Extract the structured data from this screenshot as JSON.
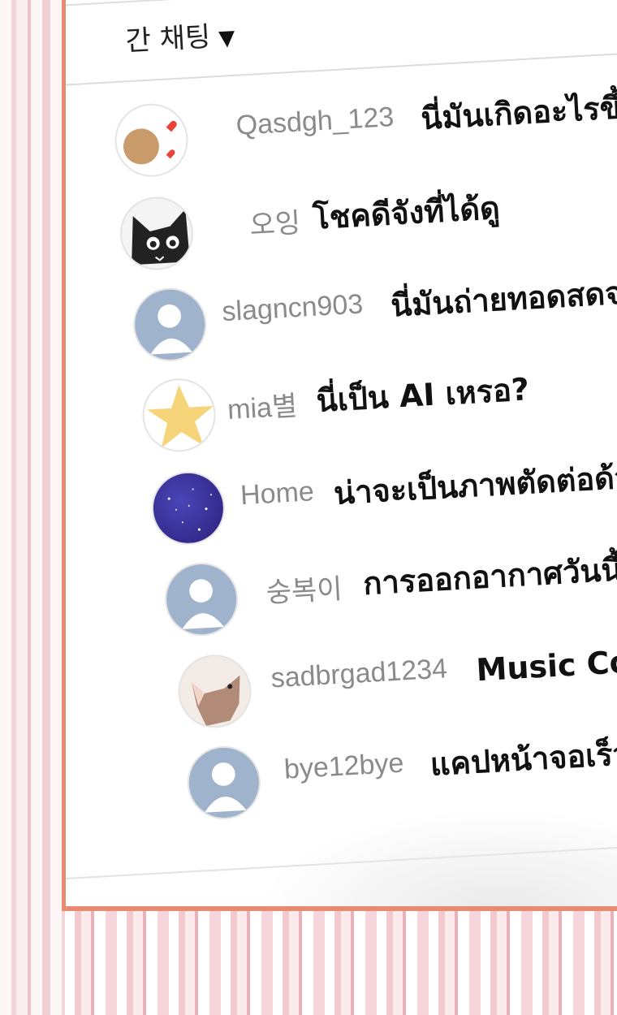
{
  "chat": {
    "title": "간 채팅",
    "caret": "▼",
    "messages": [
      {
        "user": "Qasdgh_123",
        "text": "นี่มันเกิดอะไรขึ้นกันแ",
        "avatar": "hearts-avatar"
      },
      {
        "user": "오잉",
        "text": "โชคดีจังที่ได้ดู",
        "avatar": "cat-avatar"
      },
      {
        "user": "slagncn903",
        "text": "นี่มันถ่ายทอดสดจริง",
        "avatar": "default-avatar"
      },
      {
        "user": "mia별",
        "text": "นี่เป็น AI เหรอ?",
        "avatar": "star-avatar"
      },
      {
        "user": "Home",
        "text": "น่าจะเป็นภาพตัดต่อด้วย",
        "avatar": "galaxy-avatar"
      },
      {
        "user": "숭복이",
        "text": "การออกอากาศวันนี้คือร",
        "avatar": "default-avatar"
      },
      {
        "user": "sadbrgad1234",
        "text": "Music Core ตำ",
        "avatar": "dog-avatar"
      },
      {
        "user": "bye12bye",
        "text": "แคปหน้าจอเร็ว",
        "avatar": "default-avatar"
      }
    ]
  },
  "colors": {
    "frame_border": "#e98a74",
    "username": "#8a8a8a",
    "message": "#111111",
    "default_avatar": "#9fb4cc"
  }
}
